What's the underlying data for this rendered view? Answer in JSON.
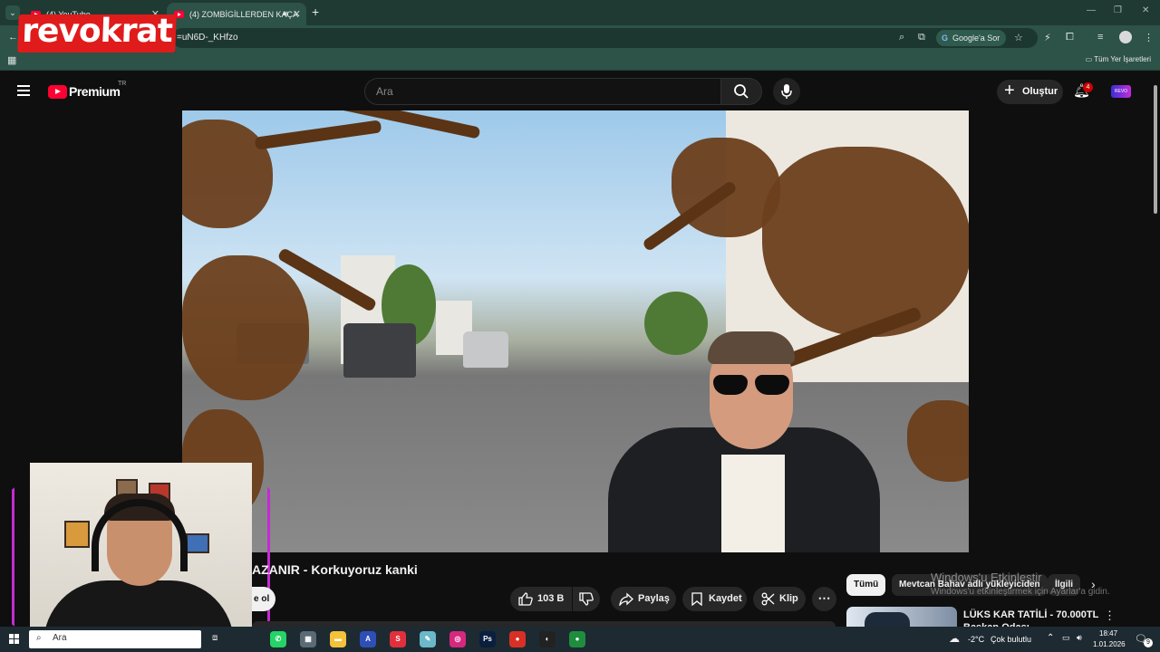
{
  "browser": {
    "tabs": [
      {
        "label": "(4) YouTube",
        "active": false
      },
      {
        "label": "(4) ZOMBİGİLLERDEN KAÇA",
        "active": true
      }
    ],
    "new_tab_icon": "+",
    "url": "=uN6D-_KHfzo",
    "gemini_button": "Google'a Sor",
    "all_bookmarks": "Tüm Yer İşaretleri",
    "window_controls": [
      "—",
      "❐",
      "✕"
    ]
  },
  "overlay": {
    "brand_logo": "revokrat"
  },
  "youtube": {
    "logo_text": "Premium",
    "country_code": "TR",
    "search": {
      "placeholder": "Ara",
      "value": ""
    },
    "create_label": "Oluştur",
    "notification_count": "4",
    "avatar_text": "REVO"
  },
  "video": {
    "title": "AZANIR - Korkuyoruz kanki",
    "subscribe_fragment": "e ol",
    "likes": "103 B",
    "share": "Paylaş",
    "save": "Kaydet",
    "clip": "Klip",
    "more": "⋯"
  },
  "sidebar": {
    "chips": [
      "Tümü",
      "Mevtcan Bahav adlı yükleyiciden",
      "İlgili"
    ],
    "recommendation": {
      "title_line1": "LÜKS KAR TATİLİ - 70.000TL",
      "title_line2": "Başkan Odası"
    }
  },
  "watermark": {
    "line1": "Windows'u Etkinleştir",
    "line2": "Windows'u etkinleştirmek için Ayarlar'a gidin."
  },
  "taskbar": {
    "search_label": "Ara",
    "weather_temp": "-2°C",
    "weather_desc": "Çok bulutlu",
    "time": "18:47",
    "date": "1.01.2026",
    "notification_count": "9",
    "apps": [
      {
        "name": "whatsapp",
        "color": "#25d366",
        "glyph": "✆"
      },
      {
        "name": "calculator",
        "color": "#5b6b76",
        "glyph": "▦"
      },
      {
        "name": "file-explorer",
        "color": "#f3c13a",
        "glyph": "▬"
      },
      {
        "name": "app-blue",
        "color": "#2f4fb8",
        "glyph": "A"
      },
      {
        "name": "app-red",
        "color": "#e1303c",
        "glyph": "S"
      },
      {
        "name": "notes",
        "color": "#6bb8c9",
        "glyph": "✎"
      },
      {
        "name": "instagram",
        "color": "#d6287e",
        "glyph": "◎"
      },
      {
        "name": "photoshop",
        "color": "#0a1f3d",
        "glyph": "Ps"
      },
      {
        "name": "chrome",
        "color": "#d93025",
        "glyph": "●"
      },
      {
        "name": "obs",
        "color": "#222",
        "glyph": "◐"
      },
      {
        "name": "chrome-profile",
        "color": "#1e8e3e",
        "glyph": "●"
      }
    ]
  },
  "colors": {
    "youtube_red": "#ff0033",
    "chrome_frame": "#2d5247",
    "cam_border": "#c42bd1"
  }
}
